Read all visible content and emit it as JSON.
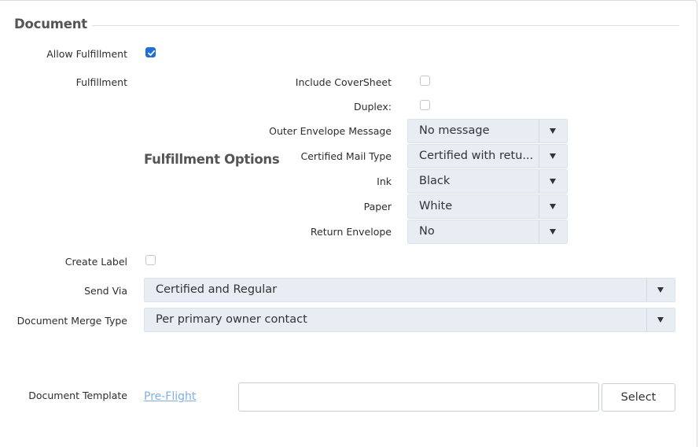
{
  "section": {
    "title": "Document"
  },
  "allow_fulfillment": {
    "label": "Allow Fulfillment",
    "checked": true
  },
  "fulfillment": {
    "label": "Fulfillment",
    "options_heading": "Fulfillment Options",
    "include_coversheet": {
      "label": "Include CoverSheet",
      "checked": false
    },
    "duplex": {
      "label": "Duplex:",
      "checked": false
    },
    "outer_envelope_message": {
      "label": "Outer Envelope Message",
      "value": "No message"
    },
    "certified_mail_type": {
      "label": "Certified Mail Type",
      "value": "Certified with retu..."
    },
    "ink": {
      "label": "Ink",
      "value": "Black"
    },
    "paper": {
      "label": "Paper",
      "value": "White"
    },
    "return_envelope": {
      "label": "Return Envelope",
      "value": "No"
    }
  },
  "create_label": {
    "label": "Create Label",
    "checked": false
  },
  "send_via": {
    "label": "Send Via",
    "value": "Certified and Regular"
  },
  "document_merge_type": {
    "label": "Document Merge Type",
    "value": "Per primary owner contact"
  },
  "document_template": {
    "label": "Document Template",
    "preflight_link": "Pre-Flight",
    "input_value": "",
    "select_button": "Select"
  },
  "colors": {
    "checkbox_checked": "#1f6fd6",
    "link": "#7fb0e6",
    "select_bg": "#e8edf4"
  },
  "icons": {
    "dropdown": "caret-down-icon",
    "check": "checkmark-icon"
  }
}
